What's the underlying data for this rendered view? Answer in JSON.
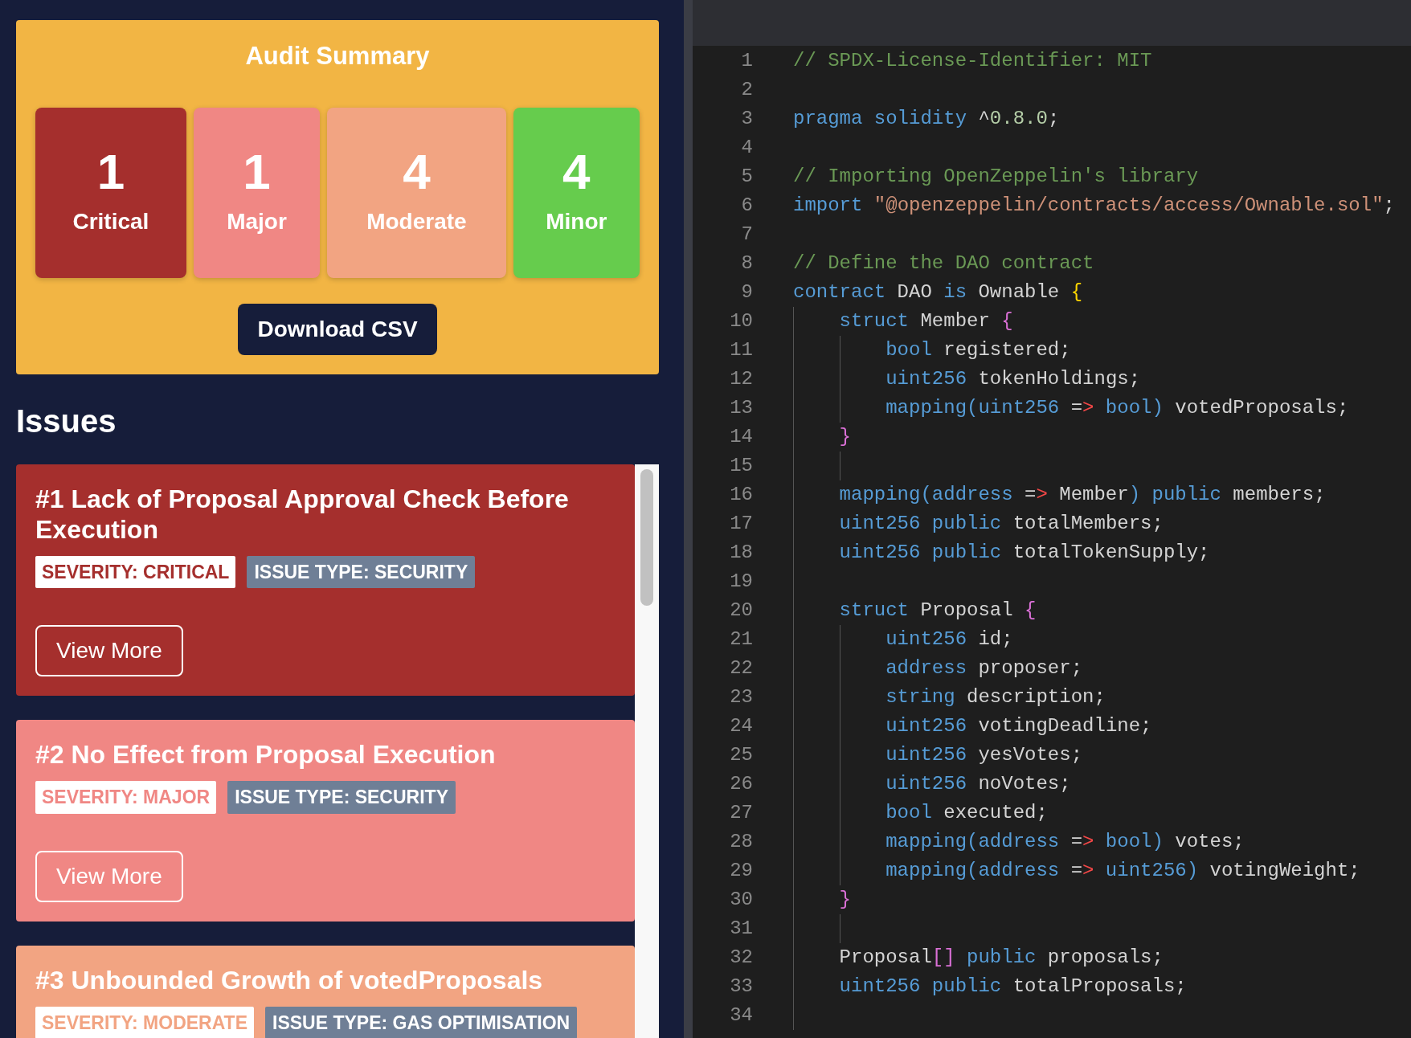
{
  "summary": {
    "title": "Audit Summary",
    "counts": [
      {
        "count": "1",
        "label": "Critical",
        "color": "#a52f2d"
      },
      {
        "count": "1",
        "label": "Major",
        "color": "#f08784"
      },
      {
        "count": "4",
        "label": "Moderate",
        "color": "#f2a482"
      },
      {
        "count": "4",
        "label": "Minor",
        "color": "#66cc4d"
      }
    ],
    "download_button": "Download CSV"
  },
  "issues_heading": "Issues",
  "issues": [
    {
      "title": "#1 Lack of Proposal Approval Check Before Execution",
      "color": "#a52f2d",
      "severity": "SEVERITY: CRITICAL",
      "issue_type": "ISSUE TYPE: SECURITY",
      "button": "View More"
    },
    {
      "title": "#2 No Effect from Proposal Execution",
      "color": "#f08784",
      "severity": "SEVERITY: MAJOR",
      "issue_type": "ISSUE TYPE: SECURITY",
      "button": "View More"
    },
    {
      "title": "#3 Unbounded Growth of votedProposals",
      "color": "#f2a482",
      "severity": "SEVERITY: MODERATE",
      "issue_type": "ISSUE TYPE: GAS OPTIMISATION"
    }
  ],
  "code_lines": [
    {
      "number": "1",
      "tokens": [
        {
          "text": "// SPDX-License-Identifier: MIT",
          "kind": "comment"
        }
      ]
    },
    {
      "number": "2"
    },
    {
      "number": "3",
      "tokens": [
        {
          "text": "pragma solidity",
          "kind": "keyword"
        },
        {
          "text": " ^",
          "kind": "plain"
        },
        {
          "text": "0.8.0",
          "kind": "number"
        },
        {
          "text": ";",
          "kind": "plain"
        }
      ]
    },
    {
      "number": "4"
    },
    {
      "number": "5",
      "tokens": [
        {
          "text": "// Importing OpenZeppelin's library",
          "kind": "comment"
        }
      ]
    },
    {
      "number": "6",
      "tokens": [
        {
          "text": "import",
          "kind": "keyword"
        },
        {
          "text": " \"@openzeppelin/contracts/access/Ownable.sol\"",
          "kind": "string"
        },
        {
          "text": ";",
          "kind": "plain"
        }
      ]
    },
    {
      "number": "7"
    },
    {
      "number": "8",
      "tokens": [
        {
          "text": "// Define the DAO contract",
          "kind": "comment"
        }
      ]
    },
    {
      "number": "9",
      "tokens": [
        {
          "text": "contract",
          "kind": "keyword"
        },
        {
          "text": " DAO ",
          "kind": "plain"
        },
        {
          "text": "is",
          "kind": "keyword"
        },
        {
          "text": " Ownable ",
          "kind": "plain"
        },
        {
          "text": "{",
          "kind": "brace1"
        }
      ]
    },
    {
      "number": "10",
      "tokens": [
        {
          "text": "    struct",
          "kind": "keyword"
        },
        {
          "text": " Member ",
          "kind": "plain"
        },
        {
          "text": "{",
          "kind": "brace2"
        }
      ]
    },
    {
      "number": "11",
      "tokens": [
        {
          "text": "        bool",
          "kind": "keyword"
        },
        {
          "text": " registered;",
          "kind": "plain"
        }
      ]
    },
    {
      "number": "12",
      "tokens": [
        {
          "text": "        uint256",
          "kind": "keyword"
        },
        {
          "text": " tokenHoldings;",
          "kind": "plain"
        }
      ]
    },
    {
      "number": "13",
      "tokens": [
        {
          "text": "        mapping(uint256 ",
          "kind": "keyword"
        },
        {
          "text": "=",
          "kind": "plain"
        },
        {
          "text": ">",
          "kind": "operator"
        },
        {
          "text": " bool)",
          "kind": "keyword"
        },
        {
          "text": " votedProposals;",
          "kind": "plain"
        }
      ]
    },
    {
      "number": "14",
      "tokens": [
        {
          "text": "    }",
          "kind": "brace2"
        }
      ]
    },
    {
      "number": "15"
    },
    {
      "number": "16",
      "tokens": [
        {
          "text": "    mapping(address ",
          "kind": "keyword"
        },
        {
          "text": "=",
          "kind": "plain"
        },
        {
          "text": ">",
          "kind": "operator"
        },
        {
          "text": " Member",
          "kind": "plain"
        },
        {
          "text": ")",
          "kind": "keyword"
        },
        {
          "text": " public",
          "kind": "keyword"
        },
        {
          "text": " members;",
          "kind": "plain"
        }
      ]
    },
    {
      "number": "17",
      "tokens": [
        {
          "text": "    uint256",
          "kind": "keyword"
        },
        {
          "text": " public",
          "kind": "keyword"
        },
        {
          "text": " totalMembers;",
          "kind": "plain"
        }
      ]
    },
    {
      "number": "18",
      "tokens": [
        {
          "text": "    uint256",
          "kind": "keyword"
        },
        {
          "text": " public",
          "kind": "keyword"
        },
        {
          "text": " totalTokenSupply;",
          "kind": "plain"
        }
      ]
    },
    {
      "number": "19"
    },
    {
      "number": "20",
      "tokens": [
        {
          "text": "    struct",
          "kind": "keyword"
        },
        {
          "text": " Proposal ",
          "kind": "plain"
        },
        {
          "text": "{",
          "kind": "brace2"
        }
      ]
    },
    {
      "number": "21",
      "tokens": [
        {
          "text": "        uint256",
          "kind": "keyword"
        },
        {
          "text": " id;",
          "kind": "plain"
        }
      ]
    },
    {
      "number": "22",
      "tokens": [
        {
          "text": "        address",
          "kind": "keyword"
        },
        {
          "text": " proposer;",
          "kind": "plain"
        }
      ]
    },
    {
      "number": "23",
      "tokens": [
        {
          "text": "        string",
          "kind": "keyword"
        },
        {
          "text": " description;",
          "kind": "plain"
        }
      ]
    },
    {
      "number": "24",
      "tokens": [
        {
          "text": "        uint256",
          "kind": "keyword"
        },
        {
          "text": " votingDeadline;",
          "kind": "plain"
        }
      ]
    },
    {
      "number": "25",
      "tokens": [
        {
          "text": "        uint256",
          "kind": "keyword"
        },
        {
          "text": " yesVotes;",
          "kind": "plain"
        }
      ]
    },
    {
      "number": "26",
      "tokens": [
        {
          "text": "        uint256",
          "kind": "keyword"
        },
        {
          "text": " noVotes;",
          "kind": "plain"
        }
      ]
    },
    {
      "number": "27",
      "tokens": [
        {
          "text": "        bool",
          "kind": "keyword"
        },
        {
          "text": " executed;",
          "kind": "plain"
        }
      ]
    },
    {
      "number": "28",
      "tokens": [
        {
          "text": "        mapping(address ",
          "kind": "keyword"
        },
        {
          "text": "=",
          "kind": "plain"
        },
        {
          "text": ">",
          "kind": "operator"
        },
        {
          "text": " bool)",
          "kind": "keyword"
        },
        {
          "text": " votes;",
          "kind": "plain"
        }
      ]
    },
    {
      "number": "29",
      "tokens": [
        {
          "text": "        mapping(address ",
          "kind": "keyword"
        },
        {
          "text": "=",
          "kind": "plain"
        },
        {
          "text": ">",
          "kind": "operator"
        },
        {
          "text": " uint256)",
          "kind": "keyword"
        },
        {
          "text": " votingWeight;",
          "kind": "plain"
        }
      ]
    },
    {
      "number": "30",
      "tokens": [
        {
          "text": "    }",
          "kind": "brace2"
        }
      ]
    },
    {
      "number": "31"
    },
    {
      "number": "32",
      "tokens": [
        {
          "text": "    Proposal",
          "kind": "plain"
        },
        {
          "text": "[]",
          "kind": "brace2"
        },
        {
          "text": " public",
          "kind": "keyword"
        },
        {
          "text": " proposals;",
          "kind": "plain"
        }
      ]
    },
    {
      "number": "33",
      "tokens": [
        {
          "text": "    uint256",
          "kind": "keyword"
        },
        {
          "text": " public",
          "kind": "keyword"
        },
        {
          "text": " totalProposals;",
          "kind": "plain"
        }
      ]
    },
    {
      "number": "34"
    }
  ]
}
